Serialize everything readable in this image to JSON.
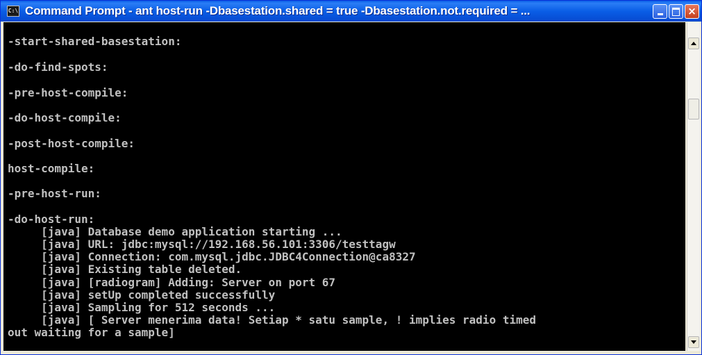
{
  "window": {
    "icon_text": "C:\\",
    "title": "Command Prompt - ant host-run -Dbasestation.shared = true -Dbasestation.not.required = ...",
    "controls": {
      "minimize": "minimize",
      "maximize": "maximize",
      "close": "×"
    }
  },
  "console": {
    "lines": [
      "-start-shared-basestation:",
      "-do-find-spots:",
      "-pre-host-compile:",
      "-do-host-compile:",
      "-post-host-compile:",
      "host-compile:",
      "-pre-host-run:",
      "-do-host-run:",
      "     [java] Database demo application starting ...",
      "     [java] URL: jdbc:mysql://192.168.56.101:3306/testtagw",
      "     [java] Connection: com.mysql.jdbc.JDBC4Connection@ca8327",
      "     [java] Existing table deleted.",
      "     [java] [radiogram] Adding: Server on port 67",
      "     [java] setUp completed successfully",
      "     [java] Sampling for 512 seconds ...",
      "     [java] [ Server menerima data! Setiap * satu sample, ! implies radio timed",
      "out waiting for a sample]"
    ]
  },
  "scrollbar": {
    "up_icon": "arrow-up-icon",
    "down_icon": "arrow-down-icon"
  },
  "colors": {
    "console_bg": "#000000",
    "console_fg": "#c0c0c0",
    "titlebar": "#0a5ee6"
  }
}
